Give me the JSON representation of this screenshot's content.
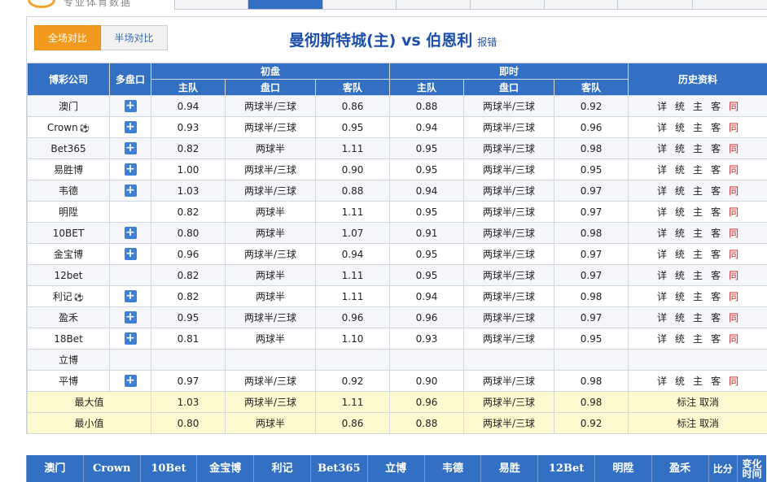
{
  "site": {
    "logo_text": "专业体育数据"
  },
  "nav": {
    "tabs": [
      "",
      "",
      "",
      "",
      "",
      "",
      "",
      ""
    ]
  },
  "switch": {
    "full": "全场对比",
    "half": "半场对比"
  },
  "match": {
    "title": "曼彻斯特城(主) vs 伯恩利",
    "report_error": "报错"
  },
  "table": {
    "headers": {
      "company": "博彩公司",
      "multi": "多盘口",
      "initial": "初盘",
      "live": "即时",
      "history": "历史资料",
      "home": "主队",
      "line": "盘口",
      "away": "客队"
    },
    "history_links": [
      "详",
      "统",
      "主",
      "客",
      "同"
    ],
    "rows": [
      {
        "name": "澳门",
        "ball": false,
        "plus": true,
        "i_home": "0.94",
        "i_line": "两球半/三球",
        "i_away": "0.86",
        "l_home": "0.88",
        "l_line": "两球半/三球",
        "l_away": "0.92",
        "hist": true
      },
      {
        "name": "Crown",
        "ball": true,
        "plus": true,
        "i_home": "0.93",
        "i_line": "两球半/三球",
        "i_away": "0.95",
        "l_home": "0.94",
        "l_line": "两球半/三球",
        "l_away": "0.96",
        "hist": true
      },
      {
        "name": "Bet365",
        "ball": false,
        "plus": true,
        "i_home": "0.82",
        "i_line": "两球半",
        "i_away": "1.11",
        "l_home": "0.95",
        "l_line": "两球半/三球",
        "l_away": "0.98",
        "hist": true
      },
      {
        "name": "易胜博",
        "ball": false,
        "plus": true,
        "i_home": "1.00",
        "i_line": "两球半/三球",
        "i_away": "0.90",
        "l_home": "0.95",
        "l_line": "两球半/三球",
        "l_away": "0.95",
        "hist": true
      },
      {
        "name": "韦德",
        "ball": false,
        "plus": true,
        "i_home": "1.03",
        "i_line": "两球半/三球",
        "i_away": "0.88",
        "l_home": "0.94",
        "l_line": "两球半/三球",
        "l_away": "0.97",
        "hist": true
      },
      {
        "name": "明陞",
        "ball": false,
        "plus": false,
        "i_home": "0.82",
        "i_line": "两球半",
        "i_away": "1.11",
        "l_home": "0.95",
        "l_line": "两球半/三球",
        "l_away": "0.97",
        "hist": true
      },
      {
        "name": "10BET",
        "ball": false,
        "plus": true,
        "i_home": "0.80",
        "i_line": "两球半",
        "i_away": "1.07",
        "l_home": "0.91",
        "l_line": "两球半/三球",
        "l_away": "0.98",
        "hist": true
      },
      {
        "name": "金宝博",
        "ball": false,
        "plus": true,
        "i_home": "0.96",
        "i_line": "两球半/三球",
        "i_away": "0.94",
        "l_home": "0.95",
        "l_line": "两球半/三球",
        "l_away": "0.97",
        "hist": true
      },
      {
        "name": "12bet",
        "ball": false,
        "plus": false,
        "i_home": "0.82",
        "i_line": "两球半",
        "i_away": "1.11",
        "l_home": "0.95",
        "l_line": "两球半/三球",
        "l_away": "0.97",
        "hist": true
      },
      {
        "name": "利记",
        "ball": true,
        "plus": true,
        "i_home": "0.82",
        "i_line": "两球半",
        "i_away": "1.11",
        "l_home": "0.94",
        "l_line": "两球半/三球",
        "l_away": "0.98",
        "hist": true
      },
      {
        "name": "盈禾",
        "ball": false,
        "plus": true,
        "i_home": "0.95",
        "i_line": "两球半/三球",
        "i_away": "0.96",
        "l_home": "0.96",
        "l_line": "两球半/三球",
        "l_away": "0.97",
        "hist": true
      },
      {
        "name": "18Bet",
        "ball": false,
        "plus": true,
        "i_home": "0.81",
        "i_line": "两球半",
        "i_away": "1.10",
        "l_home": "0.93",
        "l_line": "两球半/三球",
        "l_away": "0.95",
        "hist": true
      },
      {
        "name": "立博",
        "ball": false,
        "plus": false,
        "i_home": "",
        "i_line": "",
        "i_away": "",
        "l_home": "",
        "l_line": "",
        "l_away": "",
        "hist": false
      },
      {
        "name": "平博",
        "ball": false,
        "plus": true,
        "i_home": "0.97",
        "i_line": "两球半/三球",
        "i_away": "0.92",
        "l_home": "0.90",
        "l_line": "两球半/三球",
        "l_away": "0.98",
        "hist": true
      }
    ],
    "summary": [
      {
        "label": "最大值",
        "i_home": "1.03",
        "i_line": "两球半/三球",
        "i_away": "1.11",
        "l_home": "0.96",
        "l_line": "两球半/三球",
        "l_away": "0.98",
        "mark": "标注",
        "cancel": "取消"
      },
      {
        "label": "最小值",
        "i_home": "0.80",
        "i_line": "两球半",
        "i_away": "0.86",
        "l_home": "0.88",
        "l_line": "两球半/三球",
        "l_away": "0.92",
        "mark": "标注",
        "cancel": "取消"
      }
    ]
  },
  "bottom": {
    "companies": [
      "澳门",
      "Crown",
      "10Bet",
      "金宝博",
      "利记",
      "Bet365",
      "立博",
      "韦德",
      "易胜",
      "12Bet",
      "明陞",
      "盈禾"
    ],
    "score": "比分",
    "change_time": "变化时间"
  },
  "colors": {
    "header_blue": "#3370c4",
    "active_orange": "#f29a1e",
    "summary_yellow": "#fff9cf",
    "red_link": "#d21818"
  }
}
